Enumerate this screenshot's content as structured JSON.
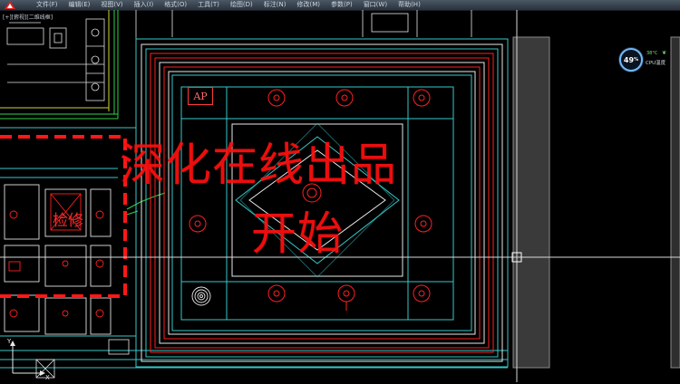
{
  "menubar": {
    "items": [
      "文件(F)",
      "编辑(E)",
      "视图(V)",
      "插入(I)",
      "格式(O)",
      "工具(T)",
      "绘图(D)",
      "标注(N)",
      "修改(M)",
      "参数(P)",
      "窗口(W)",
      "帮助(H)"
    ]
  },
  "viewport": {
    "label": "[+][俯视][二维线框]"
  },
  "drawing": {
    "ap_label": "AP",
    "check_label": "检修"
  },
  "watermark": {
    "line1": "深化在线出品",
    "line2": "开始"
  },
  "perf_widget": {
    "percent": "49",
    "percent_unit": "%",
    "temp": "38°C",
    "label": "CPU温度"
  },
  "ucs": {
    "y_label": "Y",
    "x_label": "X"
  },
  "colors": {
    "background": "#000000",
    "line_cyan": "#37c8c8",
    "line_white": "#e8e8e8",
    "line_red": "#ff2020",
    "line_green": "#2fd24a",
    "line_yellow": "#d7d230",
    "watermark": "#ff1010"
  }
}
